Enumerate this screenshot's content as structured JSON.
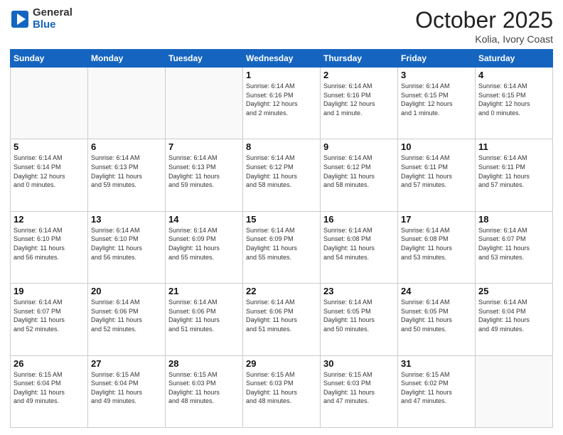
{
  "header": {
    "logo_general": "General",
    "logo_blue": "Blue",
    "month_title": "October 2025",
    "location": "Kolia, Ivory Coast"
  },
  "weekdays": [
    "Sunday",
    "Monday",
    "Tuesday",
    "Wednesday",
    "Thursday",
    "Friday",
    "Saturday"
  ],
  "weeks": [
    [
      {
        "day": "",
        "info": ""
      },
      {
        "day": "",
        "info": ""
      },
      {
        "day": "",
        "info": ""
      },
      {
        "day": "1",
        "info": "Sunrise: 6:14 AM\nSunset: 6:16 PM\nDaylight: 12 hours\nand 2 minutes."
      },
      {
        "day": "2",
        "info": "Sunrise: 6:14 AM\nSunset: 6:16 PM\nDaylight: 12 hours\nand 1 minute."
      },
      {
        "day": "3",
        "info": "Sunrise: 6:14 AM\nSunset: 6:15 PM\nDaylight: 12 hours\nand 1 minute."
      },
      {
        "day": "4",
        "info": "Sunrise: 6:14 AM\nSunset: 6:15 PM\nDaylight: 12 hours\nand 0 minutes."
      }
    ],
    [
      {
        "day": "5",
        "info": "Sunrise: 6:14 AM\nSunset: 6:14 PM\nDaylight: 12 hours\nand 0 minutes."
      },
      {
        "day": "6",
        "info": "Sunrise: 6:14 AM\nSunset: 6:13 PM\nDaylight: 11 hours\nand 59 minutes."
      },
      {
        "day": "7",
        "info": "Sunrise: 6:14 AM\nSunset: 6:13 PM\nDaylight: 11 hours\nand 59 minutes."
      },
      {
        "day": "8",
        "info": "Sunrise: 6:14 AM\nSunset: 6:12 PM\nDaylight: 11 hours\nand 58 minutes."
      },
      {
        "day": "9",
        "info": "Sunrise: 6:14 AM\nSunset: 6:12 PM\nDaylight: 11 hours\nand 58 minutes."
      },
      {
        "day": "10",
        "info": "Sunrise: 6:14 AM\nSunset: 6:11 PM\nDaylight: 11 hours\nand 57 minutes."
      },
      {
        "day": "11",
        "info": "Sunrise: 6:14 AM\nSunset: 6:11 PM\nDaylight: 11 hours\nand 57 minutes."
      }
    ],
    [
      {
        "day": "12",
        "info": "Sunrise: 6:14 AM\nSunset: 6:10 PM\nDaylight: 11 hours\nand 56 minutes."
      },
      {
        "day": "13",
        "info": "Sunrise: 6:14 AM\nSunset: 6:10 PM\nDaylight: 11 hours\nand 56 minutes."
      },
      {
        "day": "14",
        "info": "Sunrise: 6:14 AM\nSunset: 6:09 PM\nDaylight: 11 hours\nand 55 minutes."
      },
      {
        "day": "15",
        "info": "Sunrise: 6:14 AM\nSunset: 6:09 PM\nDaylight: 11 hours\nand 55 minutes."
      },
      {
        "day": "16",
        "info": "Sunrise: 6:14 AM\nSunset: 6:08 PM\nDaylight: 11 hours\nand 54 minutes."
      },
      {
        "day": "17",
        "info": "Sunrise: 6:14 AM\nSunset: 6:08 PM\nDaylight: 11 hours\nand 53 minutes."
      },
      {
        "day": "18",
        "info": "Sunrise: 6:14 AM\nSunset: 6:07 PM\nDaylight: 11 hours\nand 53 minutes."
      }
    ],
    [
      {
        "day": "19",
        "info": "Sunrise: 6:14 AM\nSunset: 6:07 PM\nDaylight: 11 hours\nand 52 minutes."
      },
      {
        "day": "20",
        "info": "Sunrise: 6:14 AM\nSunset: 6:06 PM\nDaylight: 11 hours\nand 52 minutes."
      },
      {
        "day": "21",
        "info": "Sunrise: 6:14 AM\nSunset: 6:06 PM\nDaylight: 11 hours\nand 51 minutes."
      },
      {
        "day": "22",
        "info": "Sunrise: 6:14 AM\nSunset: 6:06 PM\nDaylight: 11 hours\nand 51 minutes."
      },
      {
        "day": "23",
        "info": "Sunrise: 6:14 AM\nSunset: 6:05 PM\nDaylight: 11 hours\nand 50 minutes."
      },
      {
        "day": "24",
        "info": "Sunrise: 6:14 AM\nSunset: 6:05 PM\nDaylight: 11 hours\nand 50 minutes."
      },
      {
        "day": "25",
        "info": "Sunrise: 6:14 AM\nSunset: 6:04 PM\nDaylight: 11 hours\nand 49 minutes."
      }
    ],
    [
      {
        "day": "26",
        "info": "Sunrise: 6:15 AM\nSunset: 6:04 PM\nDaylight: 11 hours\nand 49 minutes."
      },
      {
        "day": "27",
        "info": "Sunrise: 6:15 AM\nSunset: 6:04 PM\nDaylight: 11 hours\nand 49 minutes."
      },
      {
        "day": "28",
        "info": "Sunrise: 6:15 AM\nSunset: 6:03 PM\nDaylight: 11 hours\nand 48 minutes."
      },
      {
        "day": "29",
        "info": "Sunrise: 6:15 AM\nSunset: 6:03 PM\nDaylight: 11 hours\nand 48 minutes."
      },
      {
        "day": "30",
        "info": "Sunrise: 6:15 AM\nSunset: 6:03 PM\nDaylight: 11 hours\nand 47 minutes."
      },
      {
        "day": "31",
        "info": "Sunrise: 6:15 AM\nSunset: 6:02 PM\nDaylight: 11 hours\nand 47 minutes."
      },
      {
        "day": "",
        "info": ""
      }
    ]
  ]
}
